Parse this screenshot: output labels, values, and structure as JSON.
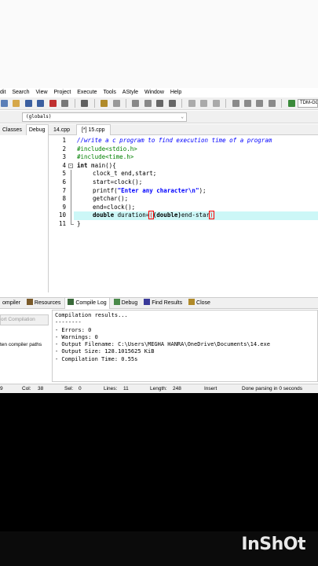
{
  "menu": [
    "dit",
    "Search",
    "View",
    "Project",
    "Execute",
    "Tools",
    "AStyle",
    "Window",
    "Help"
  ],
  "toolbar": {
    "compiler_select": "TDM-GCC"
  },
  "scope_select": "(globals)",
  "left_tabs": [
    "Classes",
    "Debug"
  ],
  "file_tabs": [
    "14.cpp",
    "[*] 15.cpp"
  ],
  "code": {
    "line_numbers": [
      "1",
      "2",
      "3",
      "4",
      "5",
      "6",
      "7",
      "8",
      "9",
      "10",
      "11"
    ],
    "l1": "//write a c program to find execution time of a program",
    "l2": "#include<stdio.h>",
    "l3": "#include<time.h>",
    "l4_kw": "int",
    "l4_rest": " main(){",
    "l5": "clock_t end,start;",
    "l6": "start=clock();",
    "l7_a": "printf(",
    "l7_str": "\"Enter any character\\n\"",
    "l7_b": ");",
    "l8": "getchar();",
    "l9": "end=clock();",
    "l10_kw": "double",
    "l10_a": " duration=",
    "l10_paren": "(",
    "l10_cast": "(double)",
    "l10_b": "end-star",
    "l10_end": ")",
    "l11": "}"
  },
  "bottom_tabs": [
    "ompiler",
    "Resources",
    "Compile Log",
    "Debug",
    "Find Results",
    "Close"
  ],
  "left_panel": {
    "abort_label": "ort Compilation",
    "shorten_label": "ten compiler paths"
  },
  "log": [
    "Compilation results...",
    "--------",
    "- Errors: 0",
    "- Warnings: 0",
    "- Output Filename: C:\\Users\\MEGHA HANRA\\OneDrive\\Documents\\14.exe",
    "- Output Size: 128.1015625 KiB",
    "- Compilation Time: 0.55s"
  ],
  "status": {
    "line": "9",
    "col_label": "Col:",
    "col": "38",
    "sel_label": "Sel:",
    "sel": "0",
    "lines_label": "Lines:",
    "lines": "11",
    "length_label": "Length:",
    "length": "248",
    "mode": "Insert",
    "message": "Done parsing in 0 seconds"
  },
  "watermark": "InShOt"
}
